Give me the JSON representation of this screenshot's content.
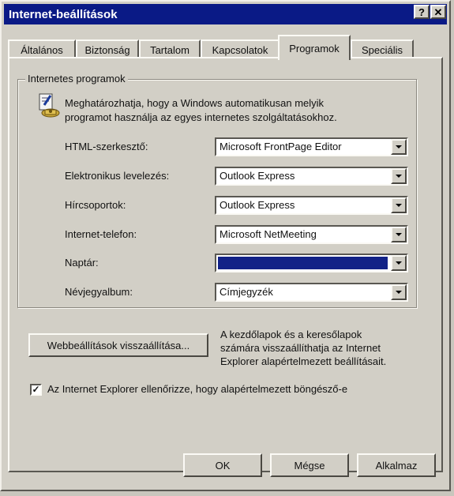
{
  "window": {
    "title": "Internet-beállítások",
    "help_button": "?",
    "close_button": "✕"
  },
  "tabs": [
    {
      "label": "Általános"
    },
    {
      "label": "Biztonság"
    },
    {
      "label": "Tartalom"
    },
    {
      "label": "Kapcsolatok"
    },
    {
      "label": "Programok",
      "active": true
    },
    {
      "label": "Speciális"
    }
  ],
  "programs_group": {
    "title": "Internetes programok",
    "description_line1": "Meghatározhatja, hogy a Windows automatikusan melyik",
    "description_line2": "programot használja az egyes internetes szolgáltatásokhoz.",
    "icon": "internet-programs-icon",
    "rows": [
      {
        "label": "HTML-szerkesztő:",
        "value": "Microsoft FrontPage Editor"
      },
      {
        "label": "Elektronikus levelezés:",
        "value": "Outlook Express"
      },
      {
        "label": "Hírcsoportok:",
        "value": "Outlook Express"
      },
      {
        "label": "Internet-telefon:",
        "value": "Microsoft NetMeeting"
      },
      {
        "label": "Naptár:",
        "value": ""
      },
      {
        "label": "Névjegyalbum:",
        "value": "Címjegyzék"
      }
    ]
  },
  "reset": {
    "button_label": "Webbeállítások visszaállítása...",
    "desc_line1": "A kezdőlapok és a keresőlapok",
    "desc_line2": "számára visszaállíthatja az Internet",
    "desc_line3": "Explorer alapértelmezett beállításait."
  },
  "default_check": {
    "label": "Az Internet Explorer ellenőrizze, hogy alapértelmezett böngésző-e",
    "checked": true,
    "mark": "✓"
  },
  "footer": {
    "ok": "OK",
    "cancel": "Mégse",
    "apply": "Alkalmaz"
  },
  "colors": {
    "titlebar": "#0a1a86",
    "face": "#d2cfc6",
    "selection": "#122287"
  }
}
